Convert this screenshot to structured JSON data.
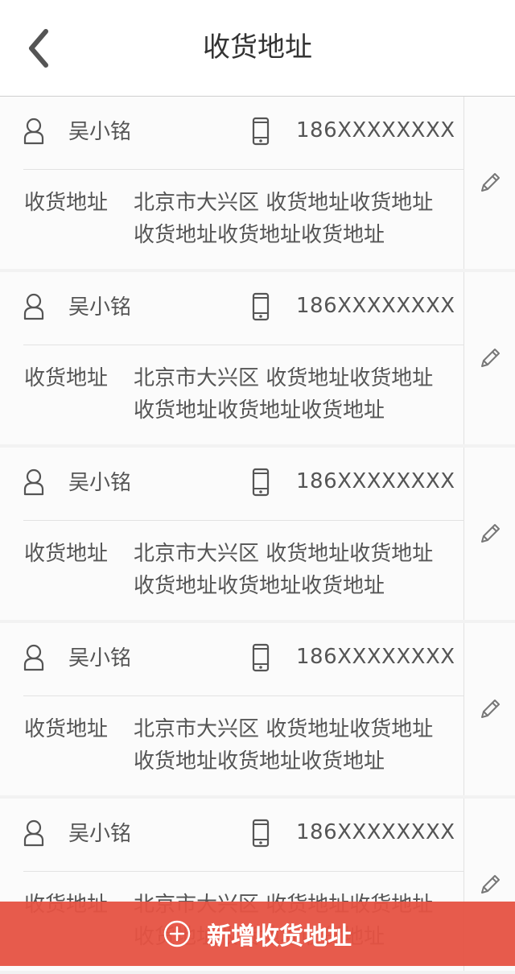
{
  "header": {
    "title": "收货地址",
    "back_icon": "chevron-left-icon"
  },
  "addresses": [
    {
      "name": "吴小铭",
      "phone": "186XXXXXXXX",
      "label": "收货地址",
      "address": "北京市大兴区  收货地址收货地址收货地址收货地址收货地址"
    },
    {
      "name": "吴小铭",
      "phone": "186XXXXXXXX",
      "label": "收货地址",
      "address": "北京市大兴区  收货地址收货地址收货地址收货地址收货地址"
    },
    {
      "name": "吴小铭",
      "phone": "186XXXXXXXX",
      "label": "收货地址",
      "address": "北京市大兴区  收货地址收货地址收货地址收货地址收货地址"
    },
    {
      "name": "吴小铭",
      "phone": "186XXXXXXXX",
      "label": "收货地址",
      "address": "北京市大兴区  收货地址收货地址收货地址收货地址收货地址"
    },
    {
      "name": "吴小铭",
      "phone": "186XXXXXXXX",
      "label": "收货地址",
      "address": "北京市大兴区  收货地址收货地址收货地址收货地址收货地址"
    }
  ],
  "icons": {
    "person": "person-icon",
    "phone": "phone-icon",
    "edit": "pencil-icon",
    "add": "plus-circle-icon"
  },
  "add_button": {
    "label": "新增收货地址"
  },
  "colors": {
    "accent": "#e65242",
    "text": "#555555",
    "background": "#f2f2f2"
  }
}
